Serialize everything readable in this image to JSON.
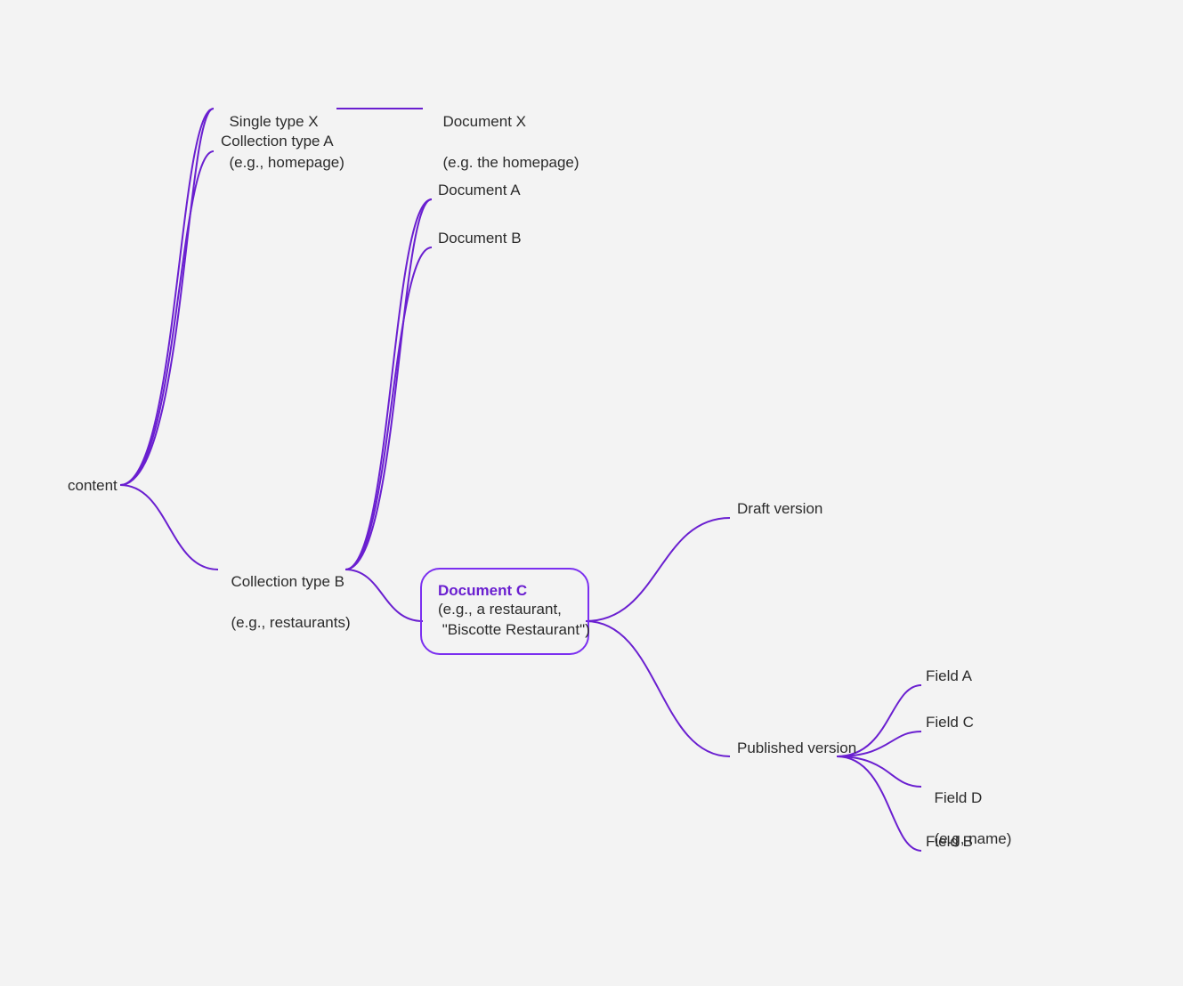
{
  "colors": {
    "edge": "#6a1fd0",
    "accent": "#6a1fd0"
  },
  "nodes": {
    "root": {
      "label": "content"
    },
    "single_x": {
      "line1": "Single type X",
      "line2": "(e.g., homepage)"
    },
    "coll_a": {
      "label": "Collection type A"
    },
    "coll_b": {
      "line1": "Collection type B",
      "line2": "(e.g., restaurants)"
    },
    "doc_x": {
      "line1": "Document X",
      "line2": "(e.g. the homepage)"
    },
    "doc_a": {
      "label": "Document A"
    },
    "doc_b": {
      "label": "Document B"
    },
    "doc_c": {
      "title": "Document C",
      "sub": "(e.g., a restaurant,\n \"Biscotte Restaurant\")"
    },
    "draft": {
      "label": "Draft version"
    },
    "published": {
      "label": "Published version"
    },
    "field_a": {
      "label": "Field A"
    },
    "field_c": {
      "label": "Field C"
    },
    "field_d": {
      "line1": "Field D",
      "line2": "(e.g, name)"
    },
    "field_b": {
      "label": "Field B"
    }
  }
}
